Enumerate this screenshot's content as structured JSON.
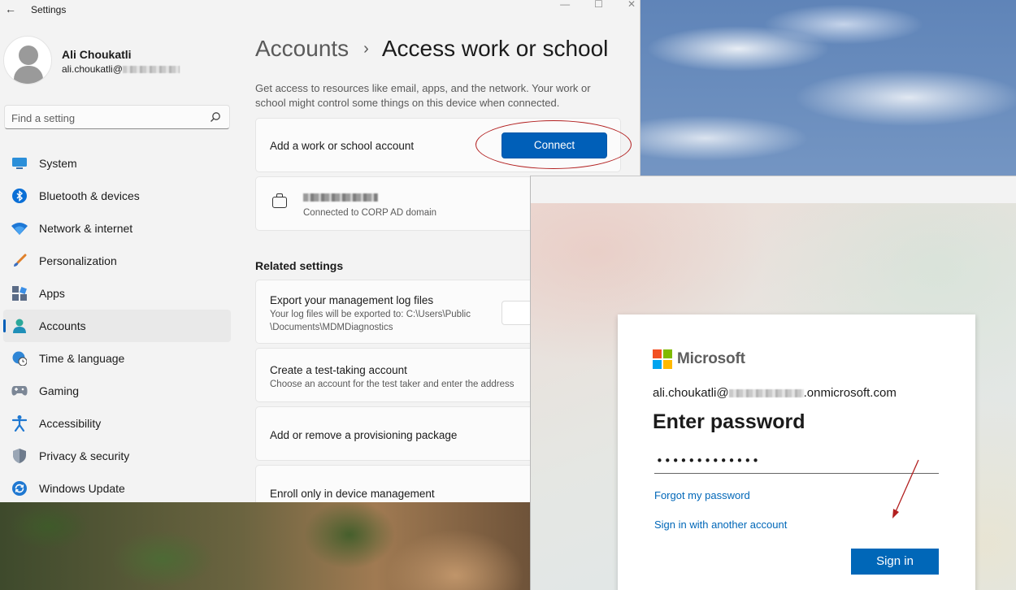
{
  "window": {
    "title": "Settings",
    "back_glyph": "←",
    "minimize_glyph": "—",
    "maximize_glyph": "☐",
    "close_glyph": "✕"
  },
  "profile": {
    "name": "Ali Choukatli",
    "email_prefix": "ali.choukatli@"
  },
  "search": {
    "placeholder": "Find a setting",
    "icon": "search-icon"
  },
  "sidebar": {
    "items": [
      {
        "label": "System",
        "icon": "monitor-icon",
        "active": false
      },
      {
        "label": "Bluetooth & devices",
        "icon": "bluetooth-icon",
        "active": false
      },
      {
        "label": "Network & internet",
        "icon": "wifi-icon",
        "active": false
      },
      {
        "label": "Personalization",
        "icon": "brush-icon",
        "active": false
      },
      {
        "label": "Apps",
        "icon": "apps-icon",
        "active": false
      },
      {
        "label": "Accounts",
        "icon": "person-icon",
        "active": true
      },
      {
        "label": "Time & language",
        "icon": "globe-clock-icon",
        "active": false
      },
      {
        "label": "Gaming",
        "icon": "gamepad-icon",
        "active": false
      },
      {
        "label": "Accessibility",
        "icon": "accessibility-icon",
        "active": false
      },
      {
        "label": "Privacy & security",
        "icon": "shield-icon",
        "active": false
      },
      {
        "label": "Windows Update",
        "icon": "update-icon",
        "active": false
      }
    ]
  },
  "main": {
    "breadcrumb_parent": "Accounts",
    "breadcrumb_separator": "›",
    "breadcrumb_current": "Access work or school",
    "description": "Get access to resources like email, apps, and the network. Your work or school might control some things on this device when connected.",
    "add_account_label": "Add a work or school account",
    "connect_label": "Connect",
    "connection_status": "Connected to CORP AD domain",
    "related_heading": "Related settings",
    "related": [
      {
        "title": "Export your management log files",
        "subtitle": "Your log files will be exported to: C:\\Users\\Public\n\\Documents\\MDMDiagnostics"
      },
      {
        "title": "Create a test-taking account",
        "subtitle": "Choose an account for the test taker and enter the address"
      },
      {
        "title": "Add or remove a provisioning package",
        "subtitle": ""
      },
      {
        "title": "Enroll only in device management",
        "subtitle": ""
      }
    ]
  },
  "signin": {
    "brand": "Microsoft",
    "email_prefix": "ali.choukatli@",
    "email_suffix": ".onmicrosoft.com",
    "heading": "Enter password",
    "password_value": "•••••••••••••",
    "forgot_link": "Forgot my password",
    "another_account_link": "Sign in with another account",
    "signin_button": "Sign in"
  },
  "colors": {
    "accent": "#005fb8",
    "ms_blue": "#0067b8",
    "annotation_red": "#b21f1f",
    "ms_red": "#f25022",
    "ms_green": "#7fba00",
    "ms_blue_tile": "#00a4ef",
    "ms_yellow": "#ffb900"
  }
}
